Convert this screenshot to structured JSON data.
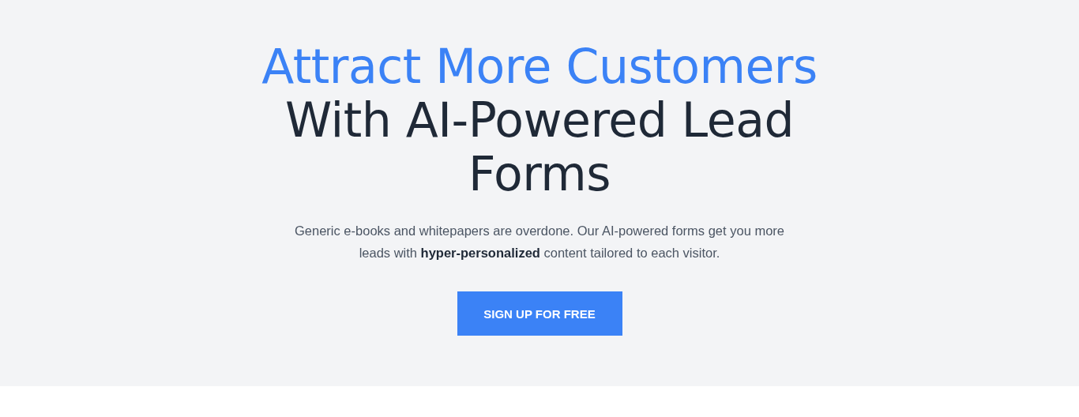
{
  "hero": {
    "headline_highlight": "Attract More Customers",
    "headline": "With AI-Powered Lead Forms",
    "description": "Generic e-books and whitepapers are overdone. Our AI-powered forms get you more leads with **hyper-personalized** content tailored to each visitor.",
    "button": "SIGN UP FOR FREE"
  }
}
